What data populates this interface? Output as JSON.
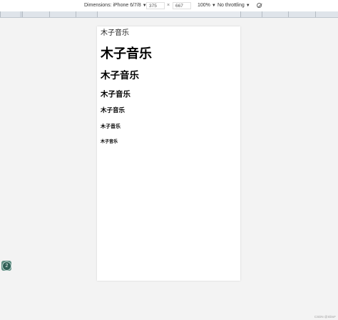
{
  "devtools_toolbar": {
    "dimensions_label": "Dimensions: iPhone 6/7/8",
    "width_value": "375",
    "times_symbol": "×",
    "height_value": "667",
    "zoom_label": "100%",
    "throttling_label": "No throttling",
    "caret_glyph": "▼"
  },
  "page": {
    "p_text": "木子音乐",
    "h1_text": "木子音乐",
    "h2_text": "木子音乐",
    "h3_text": "木子音乐",
    "h4_text": "木子音乐",
    "h5_text": "木子音乐",
    "h6_text": "木子音乐"
  },
  "badge": {
    "count": "2"
  },
  "watermark": {
    "text": "CSDN @SlimF"
  },
  "colors": {
    "toolbar_bg": "#ffffff",
    "ruler_bg": "#cfd6de",
    "viewport_bg": "#f3f3f3",
    "device_bg": "#ffffff",
    "badge_bg": "#2f5f56"
  }
}
